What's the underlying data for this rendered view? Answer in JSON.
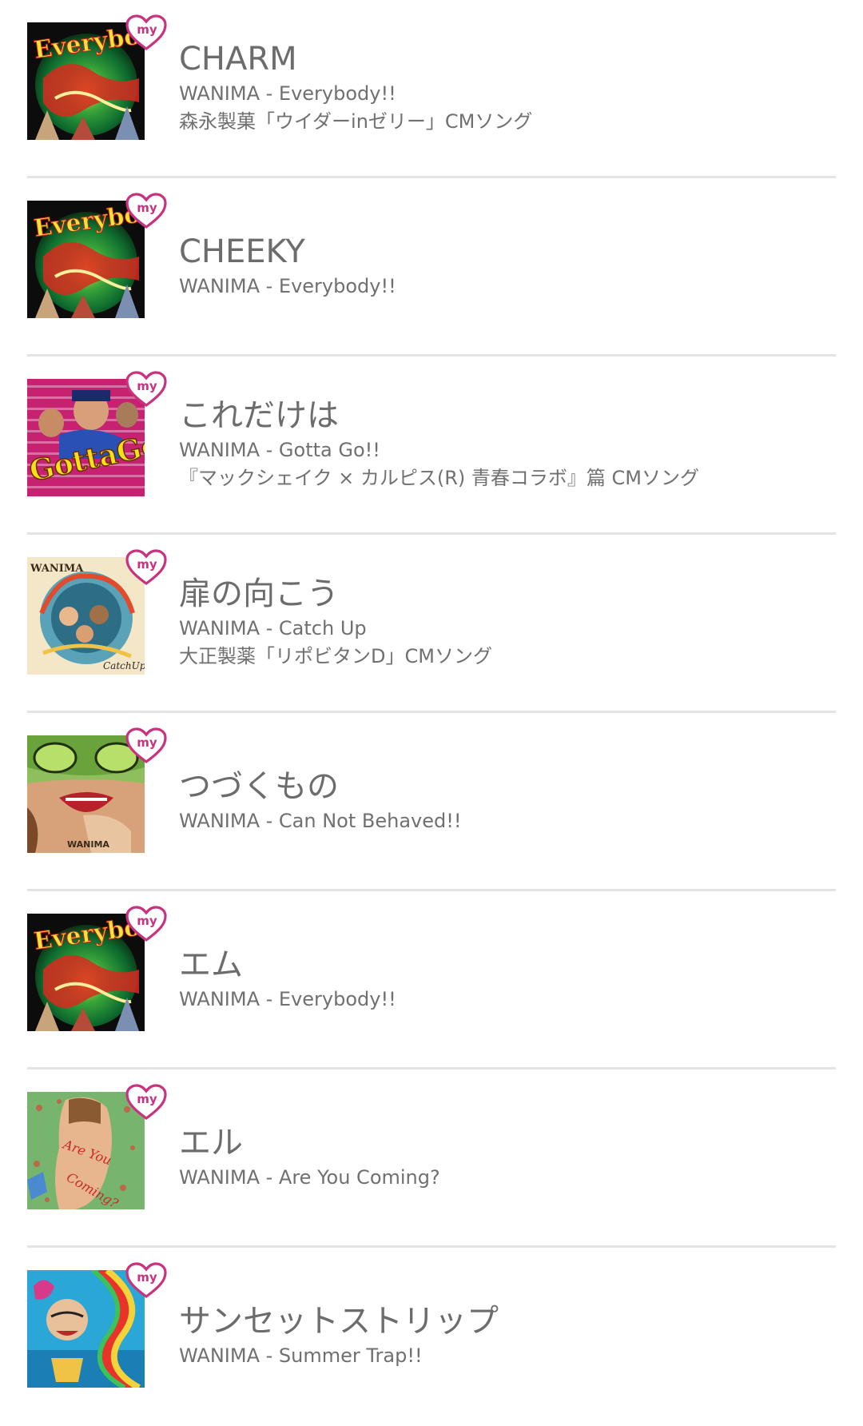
{
  "colors": {
    "divider": "#e4e4e4",
    "text": "#6f6f6f",
    "badge_heart": "#c8327f",
    "badge_text": "#c8327f"
  },
  "badge": {
    "label": "my",
    "icon": "heart-my-icon"
  },
  "songs": [
    {
      "title": "CHARM",
      "artist_album": "WANIMA - Everybody!!",
      "note": "森永製菓「ウイダーinゼリー」CMソング",
      "jacket": "everybody"
    },
    {
      "title": "CHEEKY",
      "artist_album": "WANIMA - Everybody!!",
      "note": "",
      "jacket": "everybody"
    },
    {
      "title": "これだけは",
      "artist_album": "WANIMA - Gotta Go!!",
      "note": "『マックシェイク × カルピス(R) 青春コラボ』篇 CMソング",
      "jacket": "gotta-go"
    },
    {
      "title": "扉の向こう",
      "artist_album": "WANIMA - Catch Up",
      "note": "大正製薬「リポビタンD」CMソング",
      "jacket": "catch-up"
    },
    {
      "title": "つづくもの",
      "artist_album": "WANIMA - Can Not Behaved!!",
      "note": "",
      "jacket": "can-not-behaved"
    },
    {
      "title": "エム",
      "artist_album": "WANIMA - Everybody!!",
      "note": "",
      "jacket": "everybody"
    },
    {
      "title": "エル",
      "artist_album": "WANIMA - Are You Coming?",
      "note": "",
      "jacket": "are-you-coming"
    },
    {
      "title": "サンセットストリップ",
      "artist_album": "WANIMA - Summer Trap!!",
      "note": "",
      "jacket": "summer-trap"
    }
  ]
}
